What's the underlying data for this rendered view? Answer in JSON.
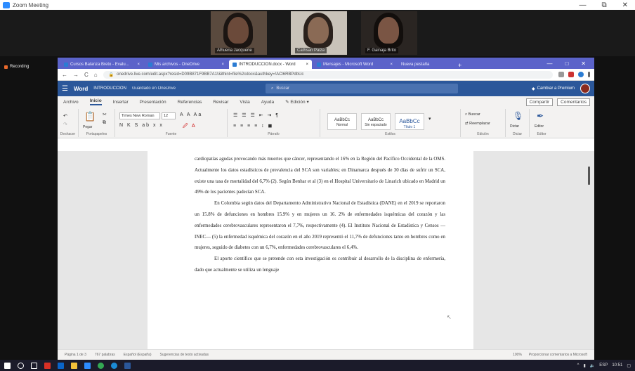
{
  "zoom": {
    "title": "Zoom Meeting",
    "window_controls": [
      "—",
      "⧉",
      "✕"
    ],
    "participants": [
      {
        "name": "Alhuena Jacquerie"
      },
      {
        "name": "Cathsan Paiza"
      },
      {
        "name": "F. Gainaja Brito"
      }
    ],
    "recording_label": "Recording"
  },
  "browser": {
    "tabs": [
      {
        "label": "Cursos Balanza Breto - Evalu..."
      },
      {
        "label": "Mis archivos - OneDrive"
      },
      {
        "label": "INTRODUCCION.docx - Word"
      },
      {
        "label": "Mensajes - Microsoft Word"
      },
      {
        "label": "Nueva pestaña"
      }
    ],
    "new_tab": "+",
    "window_controls": [
      "—",
      "□",
      "✕"
    ],
    "nav": {
      "back": "←",
      "forward": "→",
      "reload": "C",
      "home": "⌂"
    },
    "url": "onedrive.live.com/edit.aspx?resid=D09B871F9BB7A1!&ithint=file%2cdocx&authkey=!ACl6RBPdbUc"
  },
  "word": {
    "waffle": "☰",
    "app_name": "Word",
    "doc_name": "INTRODUCCIÓN",
    "saved_status": "Guardado en OneDrive",
    "search_placeholder": "Buscar",
    "premium": "Cambiar a Premium",
    "menu": [
      "Archivo",
      "Inicio",
      "Insertar",
      "Presentación",
      "Referencias",
      "Revisar",
      "Vista",
      "Ayuda",
      "Edición"
    ],
    "share_buttons": [
      "Compartir",
      "Comentarios"
    ],
    "ribbon": {
      "groups": [
        "Deshacer",
        "Portapapeles",
        "Fuente",
        "Párrafo",
        "Estilos",
        "Edición",
        "Dictar",
        "Editor"
      ],
      "paste_label": "Pegar",
      "font_name": "Times New Roman",
      "font_size": "12",
      "styles": [
        {
          "sample": "AaBbCc",
          "name": "Normal"
        },
        {
          "sample": "AaBbCc",
          "name": "Sin espaciado"
        },
        {
          "sample": "AaBbCc",
          "name": "Título 1"
        }
      ],
      "find_label": "Buscar",
      "replace_label": "Reemplazar",
      "dictate_label": "Dictar",
      "editor_label": "Editor"
    },
    "paragraphs": [
      "cardiopatías agudas provocando más muertes que cáncer, representando el 16% en la Región del Pacífico Occidental de la OMS. Actualmente los datos estadísticos de prevalencia del SCA son variables; en Dinamarca después de 30 días de sufrir un SCA, existe una tasa de mortalidad del 6,7% (2). Según Benhar et al (3) en el Hospital Universitario de Linarich ubicado en Madrid un 49% de los pacientes padecían SCA.",
      "En Colombia según datos del Departamento Administrativo Nacional de Estadística (DANE) en el 2019 se reportaron un 15.8% de defunciones en hombres 15.9% y en mujeres un 16. 2% de enfermedades isquémicas del corazón y las enfermedades cerebrovasculares representaron el 7,7%, respectivamente (4). El Instituto Nacional de Estadística y Censos —INEC— (5) la enfermedad isquémica del corazón en el año 2019 representó el 11,7% de defunciones tanto en hombres como en mujeres, seguido de diabetes con un 6,7%, enfermedades cerebrovasculares el 6,4%.",
      "El aporte científico que se pretende con esta investigación es contribuir al desarrollo de la disciplina de enfermería, dado que actualmente se utiliza un lenguaje"
    ],
    "status": {
      "page": "Página 1 de 3",
      "words": "767 palabras",
      "language": "Español (España)",
      "suggestions": "Sugerencias de texto activadas",
      "zoom": "100%",
      "feedback": "Proporcionar comentarios a Microsoft"
    }
  },
  "taskbar": {
    "time": "10:51",
    "lang": "ESP",
    "icons": [
      "start-icon",
      "search-icon",
      "taskview-icon",
      "gmail-icon",
      "mail-icon",
      "explorer-icon",
      "zoom-icon",
      "chrome-icon",
      "edge-icon",
      "word-icon"
    ]
  },
  "colors": {
    "word_blue": "#2b579a",
    "browser_tab_bar": "#5b63c9",
    "zoom_blue": "#2d8cff"
  }
}
